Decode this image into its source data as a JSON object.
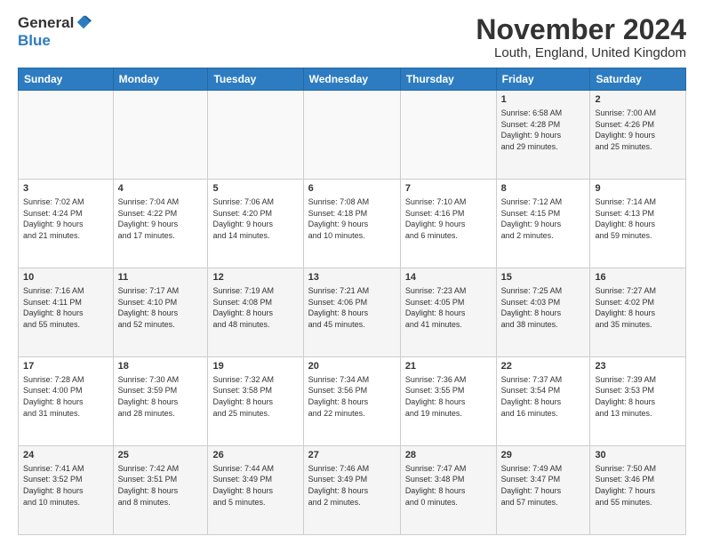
{
  "logo": {
    "general": "General",
    "blue": "Blue"
  },
  "header": {
    "month": "November 2024",
    "location": "Louth, England, United Kingdom"
  },
  "weekdays": [
    "Sunday",
    "Monday",
    "Tuesday",
    "Wednesday",
    "Thursday",
    "Friday",
    "Saturday"
  ],
  "weeks": [
    [
      {
        "day": "",
        "info": ""
      },
      {
        "day": "",
        "info": ""
      },
      {
        "day": "",
        "info": ""
      },
      {
        "day": "",
        "info": ""
      },
      {
        "day": "",
        "info": ""
      },
      {
        "day": "1",
        "info": "Sunrise: 6:58 AM\nSunset: 4:28 PM\nDaylight: 9 hours\nand 29 minutes."
      },
      {
        "day": "2",
        "info": "Sunrise: 7:00 AM\nSunset: 4:26 PM\nDaylight: 9 hours\nand 25 minutes."
      }
    ],
    [
      {
        "day": "3",
        "info": "Sunrise: 7:02 AM\nSunset: 4:24 PM\nDaylight: 9 hours\nand 21 minutes."
      },
      {
        "day": "4",
        "info": "Sunrise: 7:04 AM\nSunset: 4:22 PM\nDaylight: 9 hours\nand 17 minutes."
      },
      {
        "day": "5",
        "info": "Sunrise: 7:06 AM\nSunset: 4:20 PM\nDaylight: 9 hours\nand 14 minutes."
      },
      {
        "day": "6",
        "info": "Sunrise: 7:08 AM\nSunset: 4:18 PM\nDaylight: 9 hours\nand 10 minutes."
      },
      {
        "day": "7",
        "info": "Sunrise: 7:10 AM\nSunset: 4:16 PM\nDaylight: 9 hours\nand 6 minutes."
      },
      {
        "day": "8",
        "info": "Sunrise: 7:12 AM\nSunset: 4:15 PM\nDaylight: 9 hours\nand 2 minutes."
      },
      {
        "day": "9",
        "info": "Sunrise: 7:14 AM\nSunset: 4:13 PM\nDaylight: 8 hours\nand 59 minutes."
      }
    ],
    [
      {
        "day": "10",
        "info": "Sunrise: 7:16 AM\nSunset: 4:11 PM\nDaylight: 8 hours\nand 55 minutes."
      },
      {
        "day": "11",
        "info": "Sunrise: 7:17 AM\nSunset: 4:10 PM\nDaylight: 8 hours\nand 52 minutes."
      },
      {
        "day": "12",
        "info": "Sunrise: 7:19 AM\nSunset: 4:08 PM\nDaylight: 8 hours\nand 48 minutes."
      },
      {
        "day": "13",
        "info": "Sunrise: 7:21 AM\nSunset: 4:06 PM\nDaylight: 8 hours\nand 45 minutes."
      },
      {
        "day": "14",
        "info": "Sunrise: 7:23 AM\nSunset: 4:05 PM\nDaylight: 8 hours\nand 41 minutes."
      },
      {
        "day": "15",
        "info": "Sunrise: 7:25 AM\nSunset: 4:03 PM\nDaylight: 8 hours\nand 38 minutes."
      },
      {
        "day": "16",
        "info": "Sunrise: 7:27 AM\nSunset: 4:02 PM\nDaylight: 8 hours\nand 35 minutes."
      }
    ],
    [
      {
        "day": "17",
        "info": "Sunrise: 7:28 AM\nSunset: 4:00 PM\nDaylight: 8 hours\nand 31 minutes."
      },
      {
        "day": "18",
        "info": "Sunrise: 7:30 AM\nSunset: 3:59 PM\nDaylight: 8 hours\nand 28 minutes."
      },
      {
        "day": "19",
        "info": "Sunrise: 7:32 AM\nSunset: 3:58 PM\nDaylight: 8 hours\nand 25 minutes."
      },
      {
        "day": "20",
        "info": "Sunrise: 7:34 AM\nSunset: 3:56 PM\nDaylight: 8 hours\nand 22 minutes."
      },
      {
        "day": "21",
        "info": "Sunrise: 7:36 AM\nSunset: 3:55 PM\nDaylight: 8 hours\nand 19 minutes."
      },
      {
        "day": "22",
        "info": "Sunrise: 7:37 AM\nSunset: 3:54 PM\nDaylight: 8 hours\nand 16 minutes."
      },
      {
        "day": "23",
        "info": "Sunrise: 7:39 AM\nSunset: 3:53 PM\nDaylight: 8 hours\nand 13 minutes."
      }
    ],
    [
      {
        "day": "24",
        "info": "Sunrise: 7:41 AM\nSunset: 3:52 PM\nDaylight: 8 hours\nand 10 minutes."
      },
      {
        "day": "25",
        "info": "Sunrise: 7:42 AM\nSunset: 3:51 PM\nDaylight: 8 hours\nand 8 minutes."
      },
      {
        "day": "26",
        "info": "Sunrise: 7:44 AM\nSunset: 3:49 PM\nDaylight: 8 hours\nand 5 minutes."
      },
      {
        "day": "27",
        "info": "Sunrise: 7:46 AM\nSunset: 3:49 PM\nDaylight: 8 hours\nand 2 minutes."
      },
      {
        "day": "28",
        "info": "Sunrise: 7:47 AM\nSunset: 3:48 PM\nDaylight: 8 hours\nand 0 minutes."
      },
      {
        "day": "29",
        "info": "Sunrise: 7:49 AM\nSunset: 3:47 PM\nDaylight: 7 hours\nand 57 minutes."
      },
      {
        "day": "30",
        "info": "Sunrise: 7:50 AM\nSunset: 3:46 PM\nDaylight: 7 hours\nand 55 minutes."
      }
    ]
  ]
}
